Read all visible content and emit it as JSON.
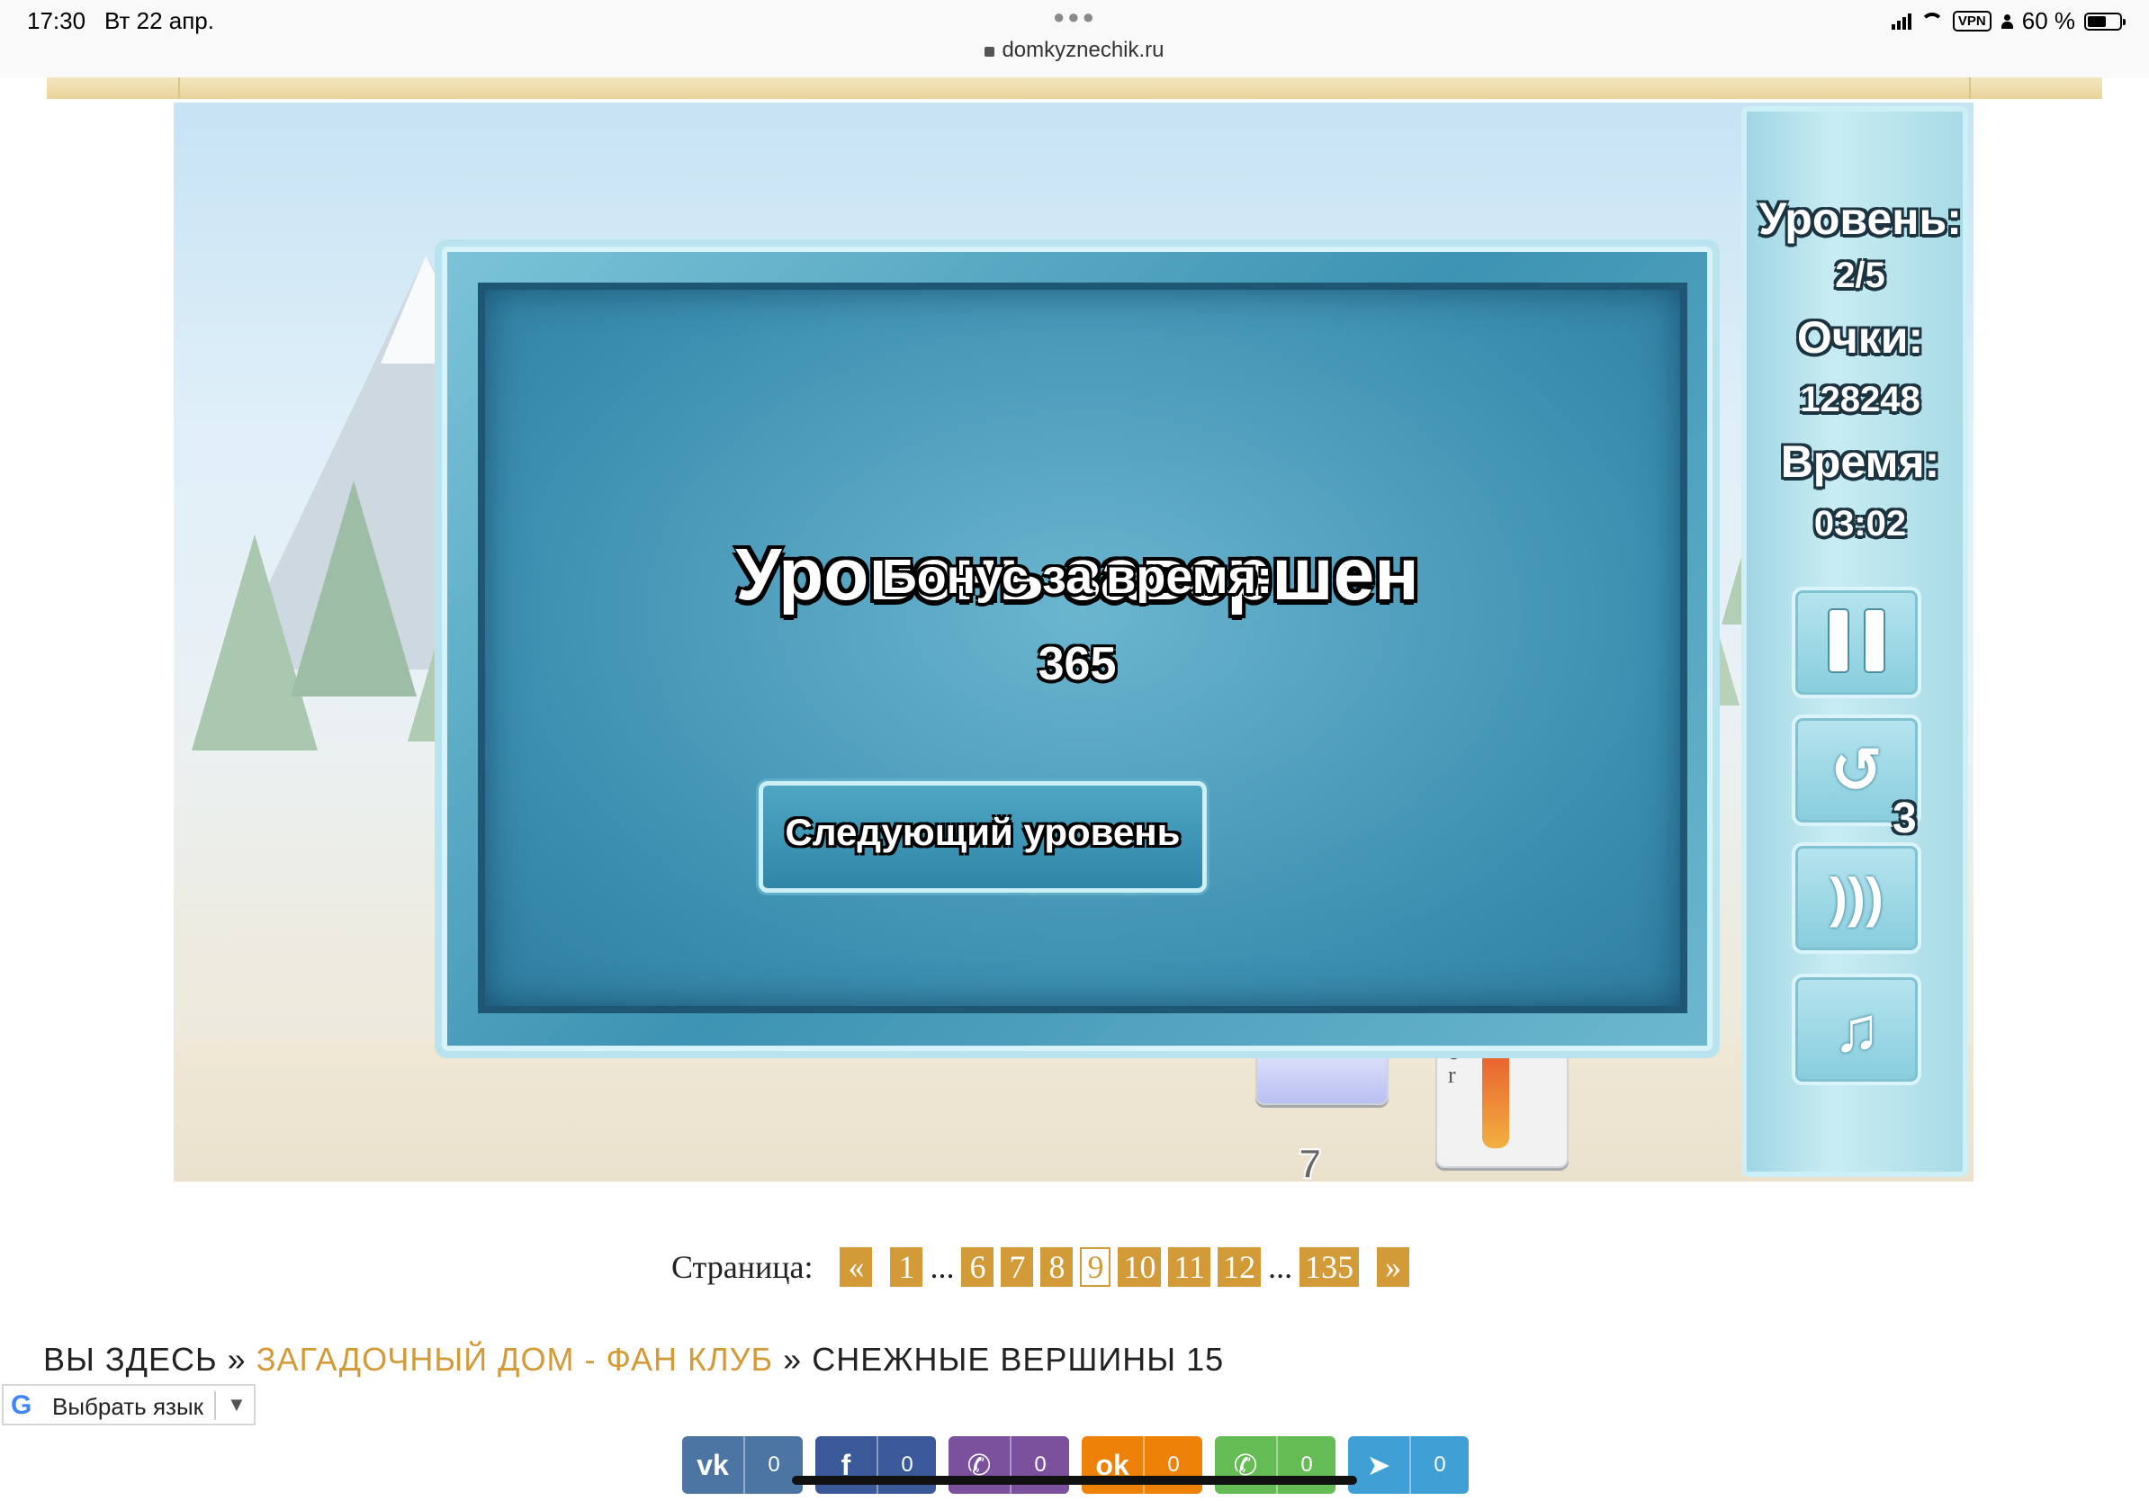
{
  "status_bar": {
    "time": "17:30",
    "date": "Вт 22 апр.",
    "url": "domkyznechik.ru",
    "vpn": "VPN",
    "battery": "60 %",
    "battery_level": 0.6
  },
  "game": {
    "sidebar": {
      "level_label": "Уровень:",
      "level_value": "2/5",
      "score_label": "Очки:",
      "score_value": "128248",
      "time_label": "Время:",
      "time_value": "03:02",
      "undo_count": "3",
      "buttons": [
        "pause-icon",
        "undo-icon",
        "sound-icon",
        "music-icon"
      ]
    },
    "card_count": "7",
    "joker_text": "e\nr",
    "dialog": {
      "title": "Уровень завершен",
      "bonus_label": "Бонус за время:",
      "bonus_value": "365",
      "next_button": "Следующий уровень"
    }
  },
  "pagination": {
    "label": "Страница:",
    "prev": "«",
    "pages": [
      "1",
      "...",
      "6",
      "7",
      "8",
      "9",
      "10",
      "11",
      "12",
      "...",
      "135"
    ],
    "current": "9",
    "next": "»"
  },
  "breadcrumbs": {
    "prefix": "ВЫ ЗДЕСЬ",
    "sep1": "»",
    "link": "ЗАГАДОЧНЫЙ ДОМ - ФАН КЛУБ",
    "sep2": "»",
    "current": "СНЕЖНЫЕ ВЕРШИНЫ 15"
  },
  "translate": {
    "label": "Выбрать язык",
    "arrow": "▼",
    "logo": "G"
  },
  "share": [
    {
      "name": "vk",
      "icon": "vk-icon",
      "glyph": "vk",
      "count": "0",
      "color": "#4c75a3"
    },
    {
      "name": "facebook",
      "icon": "facebook-icon",
      "glyph": "f",
      "count": "0",
      "color": "#3b5998"
    },
    {
      "name": "viber",
      "icon": "viber-icon",
      "glyph": "✆",
      "count": "0",
      "color": "#7b519d"
    },
    {
      "name": "odnoklassniki",
      "icon": "odnoklassniki-icon",
      "glyph": "ok",
      "count": "0",
      "color": "#ee8208"
    },
    {
      "name": "whatsapp",
      "icon": "whatsapp-icon",
      "glyph": "✆",
      "count": "0",
      "color": "#65bc54"
    },
    {
      "name": "telegram",
      "icon": "telegram-icon",
      "glyph": "➤",
      "count": "0",
      "color": "#40a0d6"
    }
  ]
}
